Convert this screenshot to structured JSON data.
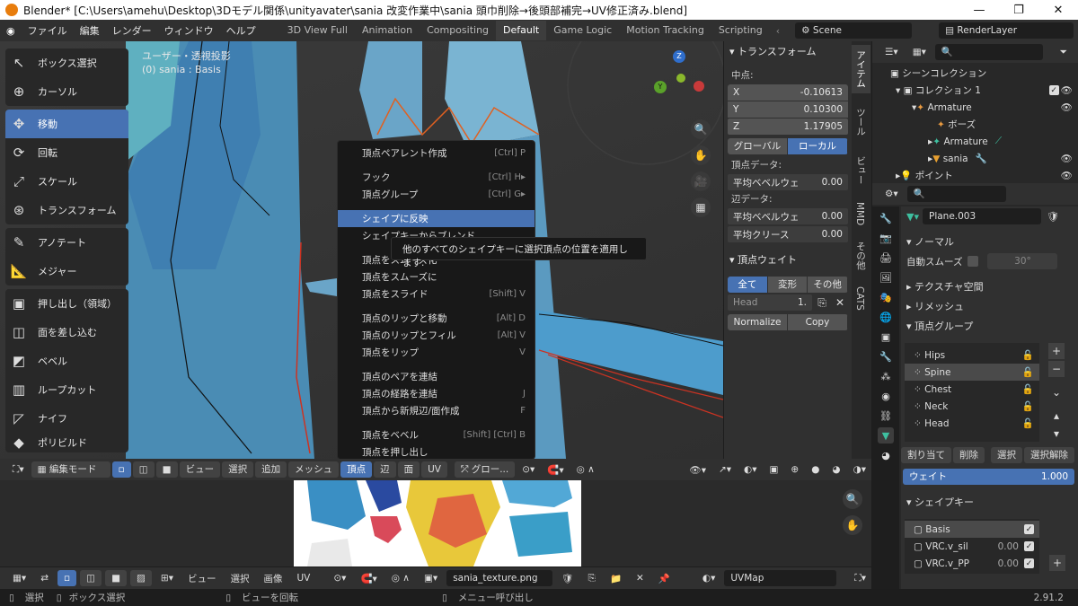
{
  "window": {
    "title": "Blender* [C:\\Users\\amehu\\Desktop\\3Dモデル関係\\unityavater\\sania 改変作業中\\sania 頭巾削除→後頭部補完→UV修正済み.blend]",
    "min": "—",
    "max": "❐",
    "close": "✕"
  },
  "menu": {
    "items": [
      "ファイル",
      "編集",
      "レンダー",
      "ウィンドウ",
      "ヘルプ"
    ]
  },
  "workspaces": [
    "3D View Full",
    "Animation",
    "Compositing",
    "Default",
    "Game Logic",
    "Motion Tracking",
    "Scripting"
  ],
  "scene": {
    "name": "Scene",
    "render_layer": "RenderLayer"
  },
  "viewport": {
    "view_name": "ユーザー・透視投影",
    "object_info": "(0) sania : Basis"
  },
  "tools": {
    "g1": [
      "ボックス選択",
      "カーソル"
    ],
    "g2": [
      "移動",
      "回転",
      "スケール",
      "トランスフォーム"
    ],
    "g3": [
      "アノテート",
      "メジャー"
    ],
    "g4": [
      "押し出し（領域）",
      "面を差し込む",
      "ベベル",
      "ループカット",
      "ナイフ",
      "ポリビルド"
    ]
  },
  "context_menu": {
    "items": [
      {
        "label": "頂点ペアレント作成",
        "shortcut": "[Ctrl] P"
      },
      {
        "label": "フック",
        "shortcut": "[Ctrl] H▸"
      },
      {
        "label": "頂点グループ",
        "shortcut": "[Ctrl] G▸"
      },
      {
        "label": "シェイプに反映",
        "shortcut": ""
      },
      {
        "label": "シェイプキーからブレンド",
        "shortcut": ""
      },
      {
        "label": "頂点をスムーズ化",
        "shortcut": ""
      },
      {
        "label": "頂点をスムーズに",
        "shortcut": ""
      },
      {
        "label": "頂点をスライド",
        "shortcut": "[Shift] V"
      },
      {
        "label": "頂点のリップと移動",
        "shortcut": "[Alt] D"
      },
      {
        "label": "頂点のリップとフィル",
        "shortcut": "[Alt] V"
      },
      {
        "label": "頂点をリップ",
        "shortcut": "V"
      },
      {
        "label": "頂点のペアを連結",
        "shortcut": ""
      },
      {
        "label": "頂点の経路を連結",
        "shortcut": "J"
      },
      {
        "label": "頂点から新規辺/面作成",
        "shortcut": "F"
      },
      {
        "label": "頂点をベベル",
        "shortcut": "[Shift] [Ctrl] B"
      },
      {
        "label": "頂点を押し出し",
        "shortcut": ""
      }
    ],
    "tooltip": "他のすべてのシェイプキーに選択頂点の位置を適用します."
  },
  "transform": {
    "header": "トランスフォーム",
    "median_label": "中点:",
    "x_label": "X",
    "x": "-0.10613",
    "y_label": "Y",
    "y": "0.10300",
    "z_label": "Z",
    "z": "1.17905",
    "global": "グローバル",
    "local": "ローカル",
    "vertex_data": "頂点データ:",
    "bevel_weight_label": "平均ベベルウェ",
    "bevel_weight": "0.00",
    "edge_data": "辺データ:",
    "edge_bevel_label": "平均ベベルウェ",
    "edge_bevel": "0.00",
    "crease_label": "平均クリース",
    "crease": "0.00"
  },
  "vertex_weights": {
    "header": "頂点ウェイト",
    "tabs": [
      "全て",
      "変形",
      "その他"
    ],
    "group": "Head",
    "value": "1.",
    "normalize": "Normalize",
    "copy": "Copy"
  },
  "side_tabs": [
    "アイテム",
    "ツール",
    "ビュー",
    "MMD",
    "その他",
    "CATS"
  ],
  "viewport_header": {
    "mode": "編集モード",
    "menus": [
      "ビュー",
      "選択",
      "追加",
      "メッシュ",
      "頂点",
      "辺",
      "面",
      "UV"
    ],
    "transform_orientation": "グロー..."
  },
  "uv_header": {
    "menus": [
      "ビュー",
      "選択",
      "画像",
      "UV"
    ],
    "image": "sania_texture.png",
    "uvmap": "UVMap"
  },
  "status": {
    "select": "選択",
    "box_select": "ボックス選択",
    "rotate_view": "ビューを回転",
    "menu": "メニュー呼び出し",
    "version": "2.91.2"
  },
  "outliner": {
    "root": "シーンコレクション",
    "collection": "コレクション 1",
    "items": [
      "Armature",
      "ボーズ",
      "Armature",
      "sania",
      "ポイント"
    ]
  },
  "properties": {
    "object_name": "Plane.003",
    "normals": "ノーマル",
    "auto_smooth": "自動スムーズ",
    "angle": "30°",
    "texture_space": "テクスチャ空間",
    "remesh": "リメッシュ",
    "vertex_groups": "頂点グループ",
    "groups": [
      "Hips",
      "Spine",
      "Chest",
      "Neck",
      "Head"
    ],
    "assign": "割り当て",
    "remove": "削除",
    "select": "選択",
    "deselect": "選択解除",
    "weight_label": "ウェイト",
    "weight": "1.000",
    "shape_keys": "シェイプキー",
    "keys": [
      {
        "name": "Basis",
        "value": ""
      },
      {
        "name": "VRC.v_sil",
        "value": "0.00"
      },
      {
        "name": "VRC.v_PP",
        "value": "0.00"
      }
    ]
  },
  "colors": {
    "accent": "#4772b3",
    "panel": "#303030",
    "dark": "#1d1d1d"
  }
}
